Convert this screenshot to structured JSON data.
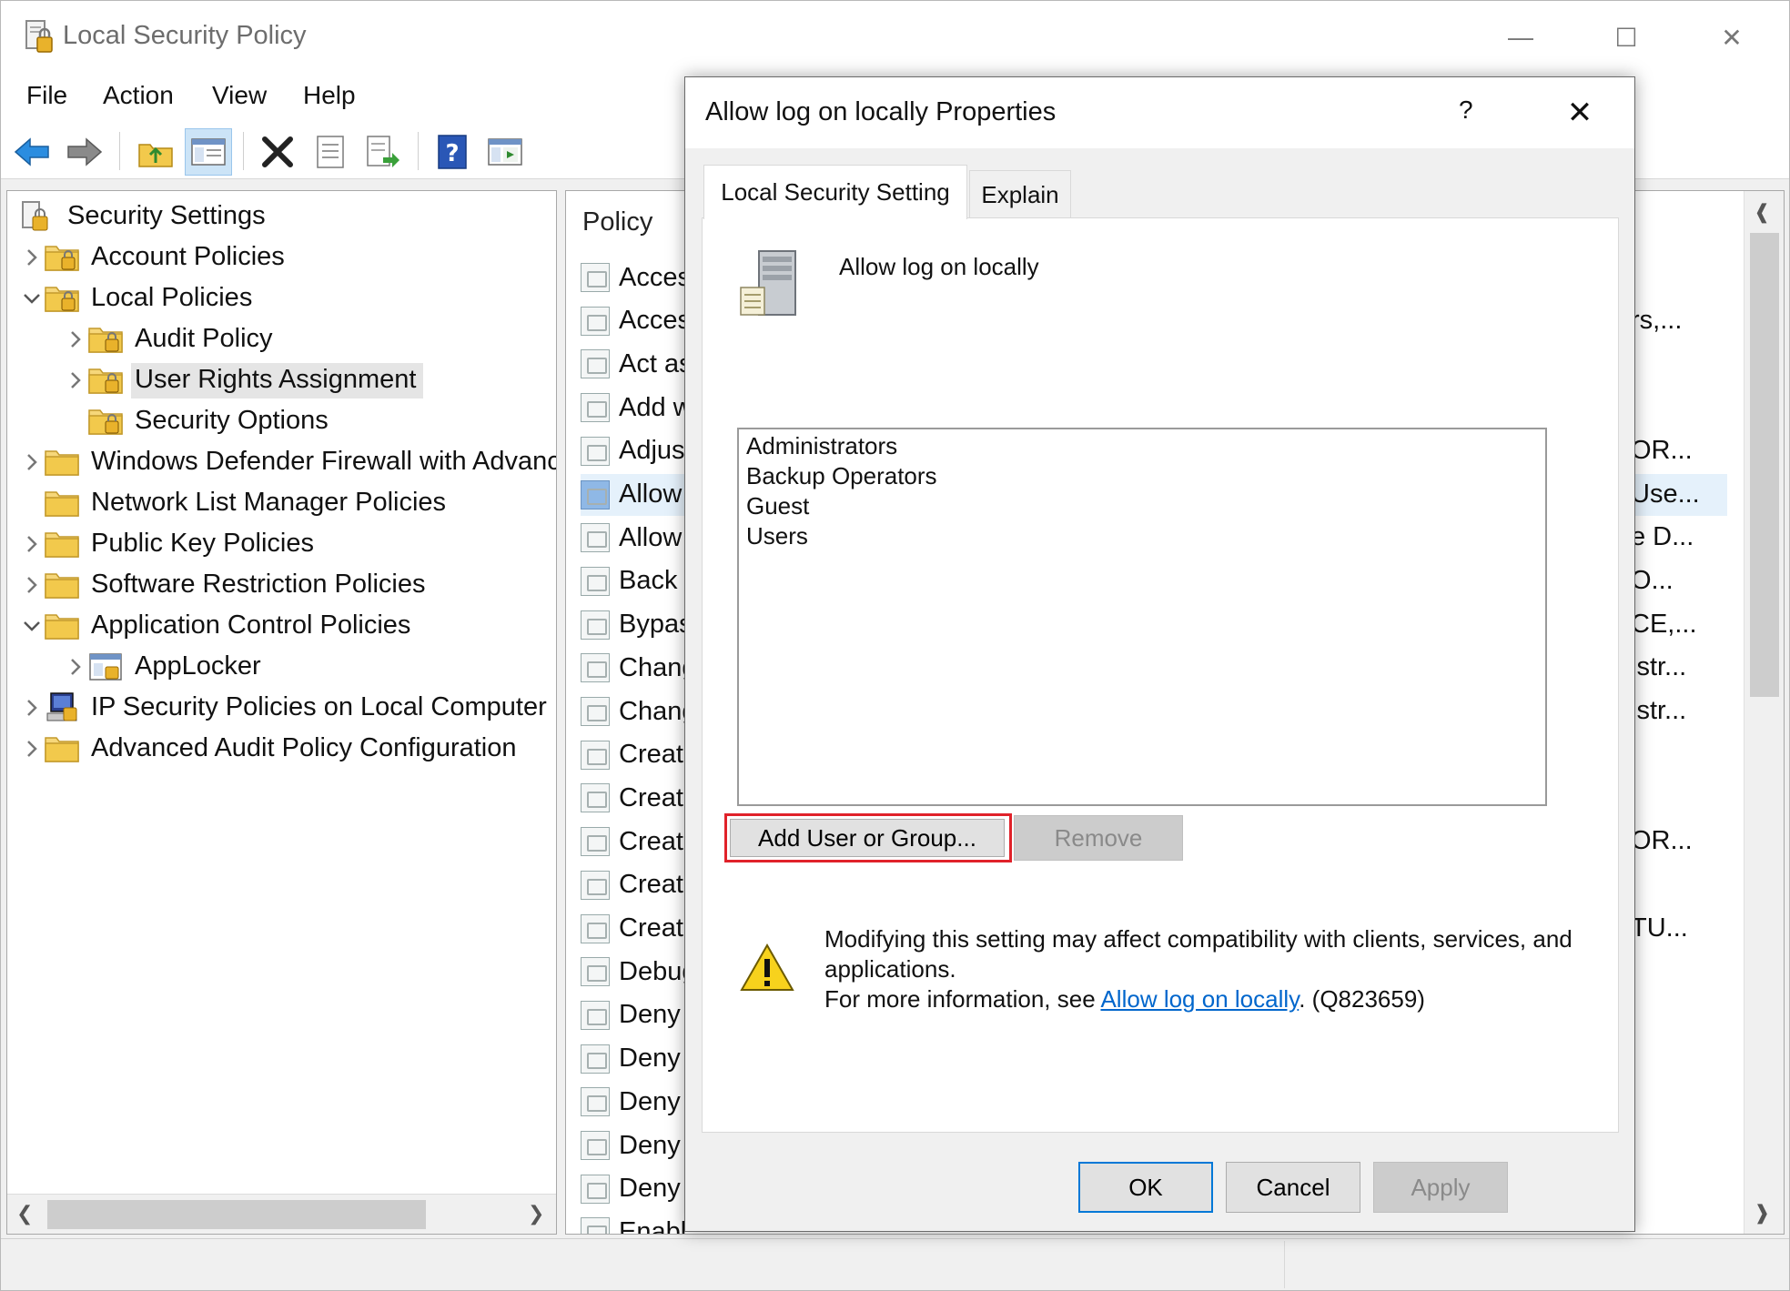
{
  "app": {
    "title": "Local Security Policy"
  },
  "window_controls": {
    "minimize": "—",
    "maximize": "☐",
    "close": "✕"
  },
  "menu": [
    "File",
    "Action",
    "View",
    "Help"
  ],
  "toolbar_icons": [
    "back-arrow-icon",
    "forward-arrow-icon",
    "up-folder-icon",
    "show-hide-tree-icon",
    "delete-icon",
    "properties-icon",
    "export-list-icon",
    "help-icon",
    "console-icon"
  ],
  "tree": {
    "items": [
      {
        "label": "Security Settings",
        "level": 0,
        "expand": "none"
      },
      {
        "label": "Account Policies",
        "level": 1,
        "expand": "collapsed"
      },
      {
        "label": "Local Policies",
        "level": 1,
        "expand": "expanded"
      },
      {
        "label": "Audit Policy",
        "level": 2,
        "expand": "collapsed"
      },
      {
        "label": "User Rights Assignment",
        "level": 2,
        "expand": "collapsed",
        "selected": true
      },
      {
        "label": "Security Options",
        "level": 2,
        "expand": "none"
      },
      {
        "label": "Windows Defender Firewall with Advanced Security",
        "level": 1,
        "expand": "collapsed"
      },
      {
        "label": "Network List Manager Policies",
        "level": 1,
        "expand": "none"
      },
      {
        "label": "Public Key Policies",
        "level": 1,
        "expand": "collapsed"
      },
      {
        "label": "Software Restriction Policies",
        "level": 1,
        "expand": "collapsed"
      },
      {
        "label": "Application Control Policies",
        "level": 1,
        "expand": "expanded"
      },
      {
        "label": "AppLocker",
        "level": 2,
        "expand": "collapsed"
      },
      {
        "label": "IP Security Policies on Local Computer",
        "level": 1,
        "expand": "collapsed"
      },
      {
        "label": "Advanced Audit Policy Configuration",
        "level": 1,
        "expand": "collapsed"
      }
    ]
  },
  "list": {
    "header": "Policy",
    "rows": [
      "Access",
      "Access",
      "Act as",
      "Add w",
      "Adjust",
      "Allow",
      "Allow",
      "Back u",
      "Bypass",
      "Chang",
      "Chang",
      "Create",
      "Create",
      "Create",
      "Create",
      "Create",
      "Debug",
      "Deny a",
      "Deny l",
      "Deny l",
      "Deny l",
      "Deny l",
      "Enabl"
    ],
    "selected_index": 5,
    "right_fragments": [
      {
        "row": 1,
        "text": "rs,..."
      },
      {
        "row": 4,
        "text": "OR..."
      },
      {
        "row": 5,
        "text": "Use..."
      },
      {
        "row": 6,
        "text": "e D..."
      },
      {
        "row": 7,
        "text": "O..."
      },
      {
        "row": 8,
        "text": "CE,..."
      },
      {
        "row": 9,
        "text": "istr..."
      },
      {
        "row": 10,
        "text": "istr..."
      },
      {
        "row": 13,
        "text": "OR..."
      },
      {
        "row": 15,
        "text": "TU..."
      }
    ]
  },
  "dialog": {
    "title": "Allow log on locally Properties",
    "help": "?",
    "close": "✕",
    "tabs": [
      "Local Security Setting",
      "Explain"
    ],
    "policy_name": "Allow log on locally",
    "members": [
      "Administrators",
      "Backup Operators",
      "Guest",
      "Users"
    ],
    "add_button": "Add User or Group...",
    "remove_button": "Remove",
    "warning_line1": "Modifying this setting may affect compatibility with clients, services, and applications.",
    "warning_prefix": "For more information, see ",
    "warning_link": "Allow log on locally",
    "warning_suffix": ". (Q823659)",
    "ok": "OK",
    "cancel": "Cancel",
    "apply": "Apply"
  },
  "colors": {
    "accent": "#0078d7",
    "highlight_frame": "#e0222a",
    "link": "#0066cc"
  }
}
